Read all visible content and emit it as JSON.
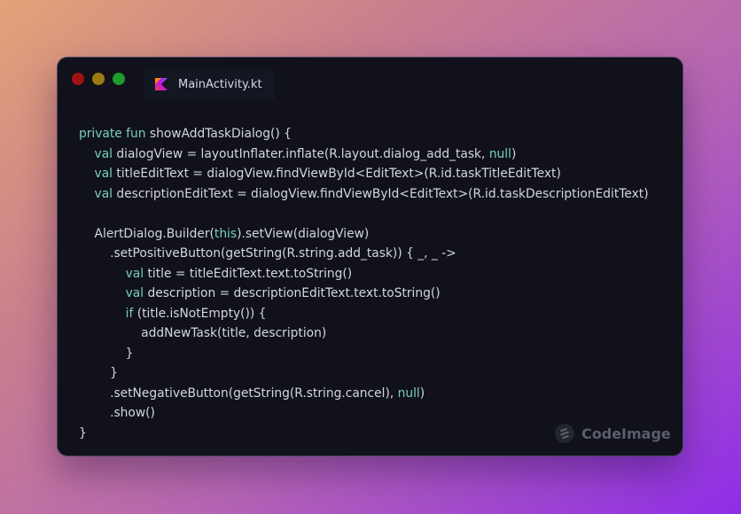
{
  "window": {
    "tab_label": "MainActivity.kt",
    "watermark": "CodeImage"
  },
  "colors": {
    "keyword": "#79d0b8",
    "text": "#d3d5e0",
    "background": "#10111a"
  },
  "code_lines": [
    [
      {
        "t": "private fun ",
        "k": true
      },
      {
        "t": "showAddTaskDialog() {"
      }
    ],
    [
      {
        "t": "    "
      },
      {
        "t": "val ",
        "k": true
      },
      {
        "t": "dialogView = layoutInflater.inflate(R.layout.dialog_add_task, "
      },
      {
        "t": "null",
        "k": true
      },
      {
        "t": ")"
      }
    ],
    [
      {
        "t": "    "
      },
      {
        "t": "val ",
        "k": true
      },
      {
        "t": "titleEditText = dialogView.findViewById<EditText>(R.id.taskTitleEditText)"
      }
    ],
    [
      {
        "t": "    "
      },
      {
        "t": "val ",
        "k": true
      },
      {
        "t": "descriptionEditText = dialogView.findViewById<EditText>(R.id.taskDescriptionEditText)"
      }
    ],
    [
      {
        "t": ""
      }
    ],
    [
      {
        "t": "    AlertDialog.Builder("
      },
      {
        "t": "this",
        "k": true
      },
      {
        "t": ").setView(dialogView)"
      }
    ],
    [
      {
        "t": "        .setPositiveButton(getString(R.string.add_task)) { _, _ ->"
      }
    ],
    [
      {
        "t": "            "
      },
      {
        "t": "val ",
        "k": true
      },
      {
        "t": "title = titleEditText.text.toString()"
      }
    ],
    [
      {
        "t": "            "
      },
      {
        "t": "val ",
        "k": true
      },
      {
        "t": "description = descriptionEditText.text.toString()"
      }
    ],
    [
      {
        "t": "            "
      },
      {
        "t": "if ",
        "k": true
      },
      {
        "t": "(title.isNotEmpty()) {"
      }
    ],
    [
      {
        "t": "                addNewTask(title, description)"
      }
    ],
    [
      {
        "t": "            }"
      }
    ],
    [
      {
        "t": "        }"
      }
    ],
    [
      {
        "t": "        .setNegativeButton(getString(R.string.cancel), "
      },
      {
        "t": "null",
        "k": true
      },
      {
        "t": ")"
      }
    ],
    [
      {
        "t": "        .show()"
      }
    ],
    [
      {
        "t": "}"
      }
    ]
  ]
}
